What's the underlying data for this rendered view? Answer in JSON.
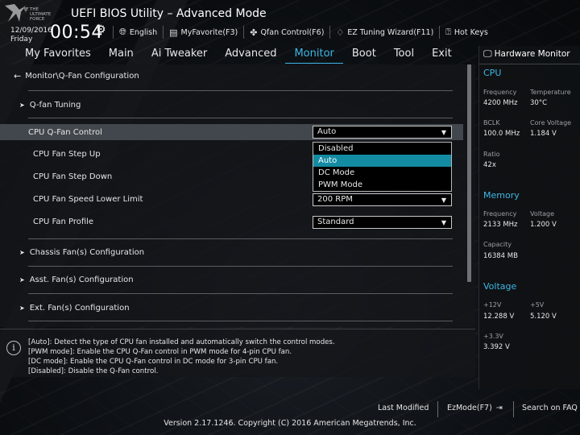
{
  "header": {
    "app_title": "UEFI BIOS Utility – Advanced Mode",
    "date": "12/09/2016",
    "day": "Friday",
    "time": "00:54",
    "tools": [
      {
        "icon": "globe-icon",
        "label": "English"
      },
      {
        "icon": "star-icon",
        "label": "MyFavorite(F3)"
      },
      {
        "icon": "fan-icon",
        "label": "Qfan Control(F6)"
      },
      {
        "icon": "bulb-icon",
        "label": "EZ Tuning Wizard(F11)"
      },
      {
        "icon": "help-icon",
        "label": "Hot Keys"
      }
    ],
    "logo_text": "THE ULTIMATE FORCE"
  },
  "nav": {
    "items": [
      "My Favorites",
      "Main",
      "Ai Tweaker",
      "Advanced",
      "Monitor",
      "Boot",
      "Tool",
      "Exit"
    ],
    "active": "Monitor"
  },
  "main": {
    "breadcrumb": "Monitor\\Q-Fan Configuration",
    "qfan_tuning": "Q-fan Tuning",
    "cpu_qfan_control": {
      "label": "CPU Q-Fan Control",
      "value": "Auto"
    },
    "cpu_fan_step_up": "CPU Fan Step Up",
    "cpu_fan_step_down": "CPU Fan Step Down",
    "cpu_fan_speed_lower_limit": {
      "label": "CPU Fan Speed Lower Limit",
      "value": "200 RPM"
    },
    "cpu_fan_profile": {
      "label": "CPU Fan Profile",
      "value": "Standard"
    },
    "dropdown_options": [
      "Disabled",
      "Auto",
      "DC Mode",
      "PWM Mode"
    ],
    "dropdown_selected": "Auto",
    "sections": [
      "Chassis Fan(s) Configuration",
      "Asst. Fan(s) Configuration",
      "Ext. Fan(s) Configuration"
    ]
  },
  "help": {
    "lines": [
      "[Auto]: Detect the type of CPU fan installed and automatically switch the control modes.",
      "[PWM mode]: Enable the CPU Q-Fan control in PWM mode for 4-pin CPU fan.",
      "[DC mode]: Enable the CPU Q-Fan control in DC mode for 3-pin CPU fan.",
      "[Disabled]: Disable the Q-Fan control."
    ]
  },
  "hardware_monitor": {
    "title": "Hardware Monitor",
    "cpu": {
      "section": "CPU",
      "frequency_label": "Frequency",
      "frequency": "4200 MHz",
      "temperature_label": "Temperature",
      "temperature": "30°C",
      "bclk_label": "BCLK",
      "bclk": "100.0 MHz",
      "core_voltage_label": "Core Voltage",
      "core_voltage": "1.184 V",
      "ratio_label": "Ratio",
      "ratio": "42x"
    },
    "memory": {
      "section": "Memory",
      "frequency_label": "Frequency",
      "frequency": "2133 MHz",
      "voltage_label": "Voltage",
      "voltage": "1.200 V",
      "capacity_label": "Capacity",
      "capacity": "16384 MB"
    },
    "voltage": {
      "section": "Voltage",
      "v12_label": "+12V",
      "v12": "12.288 V",
      "v5_label": "+5V",
      "v5": "5.120 V",
      "v33_label": "+3.3V",
      "v33": "3.392 V"
    }
  },
  "footer": {
    "last_modified": "Last Modified",
    "ezmode": "EzMode(F7)",
    "search_faq": "Search on FAQ",
    "copyright": "Version 2.17.1246. Copyright (C) 2016 American Megatrends, Inc."
  },
  "colors": {
    "accent": "#3fb7e6",
    "selection": "#138ba3",
    "row_highlight": "#42474d"
  }
}
